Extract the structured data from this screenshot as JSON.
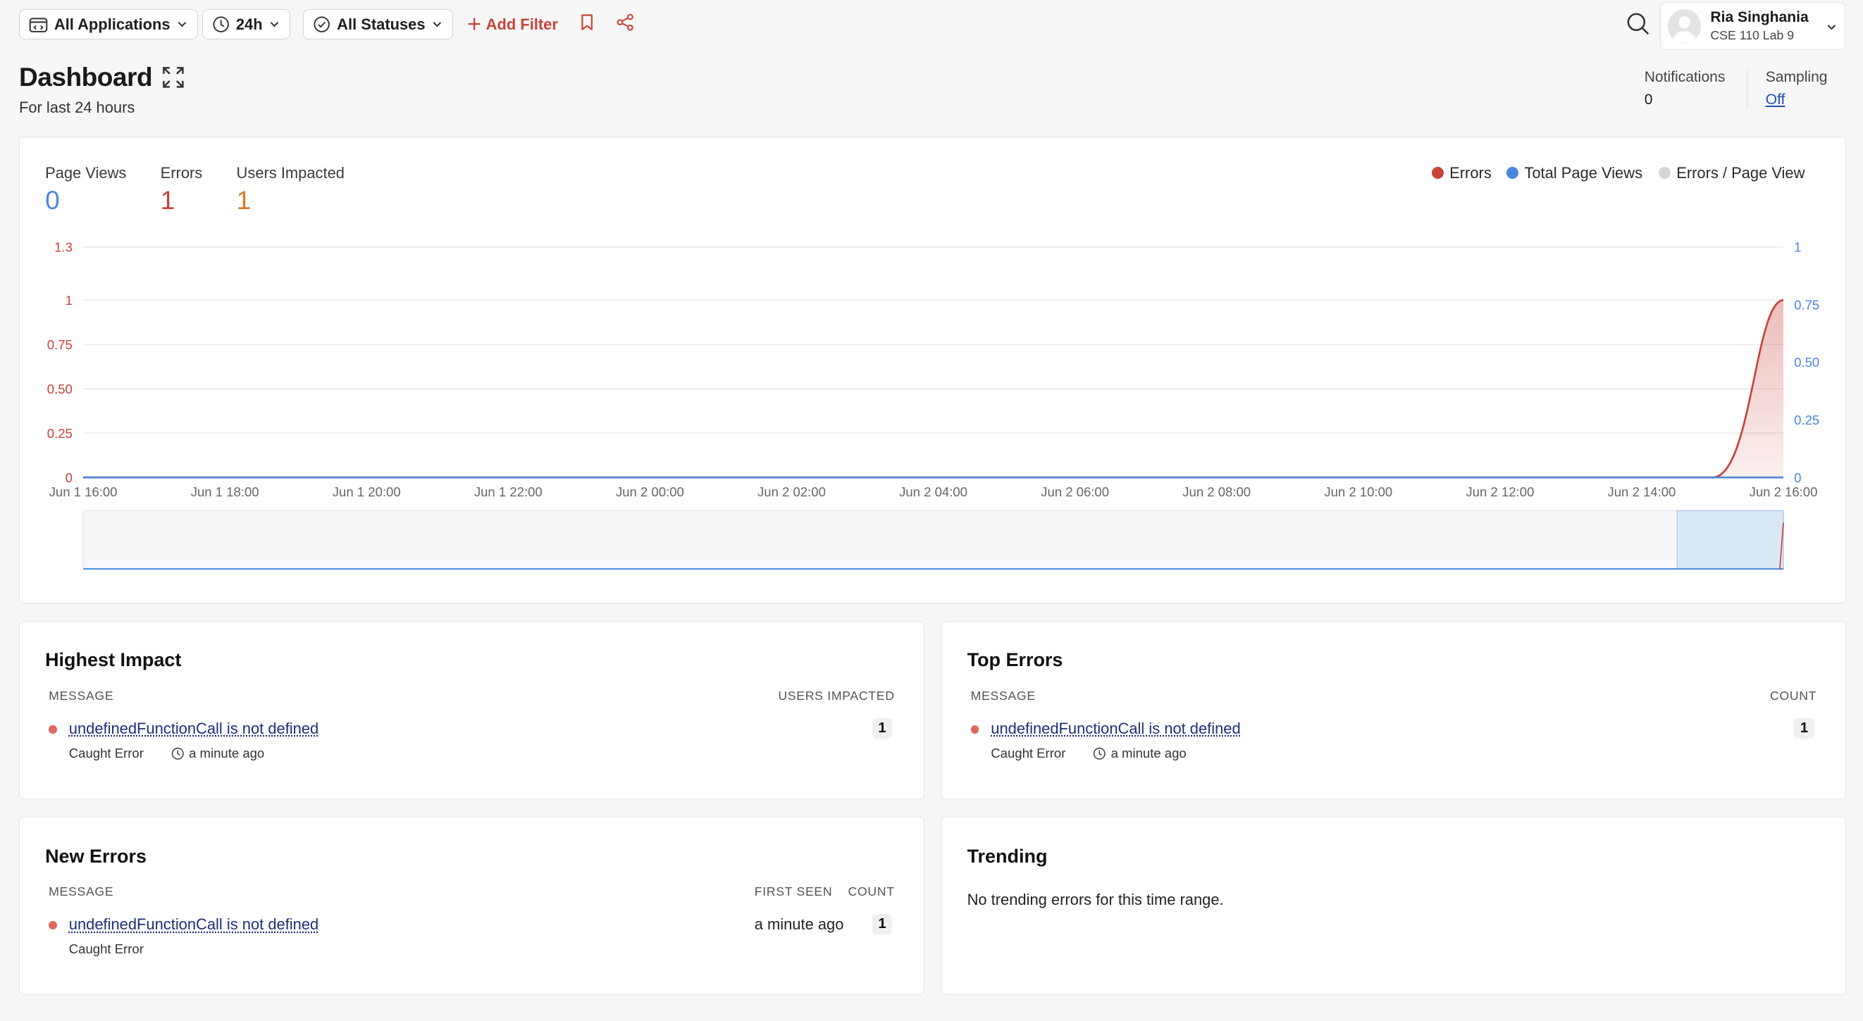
{
  "toolbar": {
    "applications_label": "All Applications",
    "time_range_label": "24h",
    "status_label": "All Statuses",
    "add_filter_label": "Add Filter"
  },
  "user": {
    "name": "Ria Singhania",
    "project": "CSE 110 Lab 9"
  },
  "header": {
    "title": "Dashboard",
    "subtitle": "For last 24 hours",
    "notifications_label": "Notifications",
    "notifications_value": "0",
    "sampling_label": "Sampling",
    "sampling_value": "Off"
  },
  "metrics": [
    {
      "label": "Page Views",
      "value": "0",
      "color": "#4a86e0"
    },
    {
      "label": "Errors",
      "value": "1",
      "color": "#c9423a"
    },
    {
      "label": "Users Impacted",
      "value": "1",
      "color": "#d9782c"
    }
  ],
  "legend": [
    {
      "label": "Errors",
      "color": "#c9423a"
    },
    {
      "label": "Total Page Views",
      "color": "#4a86e0"
    },
    {
      "label": "Errors / Page View",
      "color": "#d6d6d6"
    }
  ],
  "chart_data": {
    "type": "area",
    "x": [
      "Jun 1 16:00",
      "Jun 1 18:00",
      "Jun 1 20:00",
      "Jun 1 22:00",
      "Jun 2 00:00",
      "Jun 2 02:00",
      "Jun 2 04:00",
      "Jun 2 06:00",
      "Jun 2 08:00",
      "Jun 2 10:00",
      "Jun 2 12:00",
      "Jun 2 14:00",
      "Jun 2 15:00",
      "Jun 2 16:00"
    ],
    "series": [
      {
        "name": "Errors",
        "axis": "left",
        "values": [
          0,
          0,
          0,
          0,
          0,
          0,
          0,
          0,
          0,
          0,
          0,
          0,
          0,
          1
        ]
      },
      {
        "name": "Total Page Views",
        "axis": "right",
        "values": [
          0,
          0,
          0,
          0,
          0,
          0,
          0,
          0,
          0,
          0,
          0,
          0,
          0,
          0
        ]
      }
    ],
    "left_axis": {
      "ticks": [
        "0",
        "0.25",
        "0.50",
        "0.75",
        "1",
        "1.3"
      ],
      "range": [
        0,
        1.3
      ]
    },
    "right_axis": {
      "ticks": [
        "0",
        "0.25",
        "0.50",
        "0.75",
        "1"
      ],
      "range": [
        0,
        1
      ]
    },
    "x_tick_labels": [
      "Jun 1 16:00",
      "Jun 1 18:00",
      "Jun 1 20:00",
      "Jun 1 22:00",
      "Jun 2 00:00",
      "Jun 2 02:00",
      "Jun 2 04:00",
      "Jun 2 06:00",
      "Jun 2 08:00",
      "Jun 2 10:00",
      "Jun 2 12:00",
      "Jun 2 14:00",
      "Jun 2 16:00"
    ],
    "grid": true,
    "brush_range": [
      "Jun 2 14:30",
      "Jun 2 16:00"
    ]
  },
  "highest_impact": {
    "title": "Highest Impact",
    "col_message": "MESSAGE",
    "col_users": "USERS IMPACTED",
    "rows": [
      {
        "message": "undefinedFunctionCall is not defined",
        "type": "Caught Error",
        "time": "a minute ago",
        "users": "1"
      }
    ]
  },
  "top_errors": {
    "title": "Top Errors",
    "col_message": "MESSAGE",
    "col_count": "COUNT",
    "rows": [
      {
        "message": "undefinedFunctionCall is not defined",
        "type": "Caught Error",
        "time": "a minute ago",
        "count": "1"
      }
    ]
  },
  "new_errors": {
    "title": "New Errors",
    "col_message": "MESSAGE",
    "col_first_seen": "FIRST SEEN",
    "col_count": "COUNT",
    "rows": [
      {
        "message": "undefinedFunctionCall is not defined",
        "type": "Caught Error",
        "first_seen": "a minute ago",
        "count": "1"
      }
    ]
  },
  "trending": {
    "title": "Trending",
    "empty_message": "No trending errors for this time range."
  }
}
